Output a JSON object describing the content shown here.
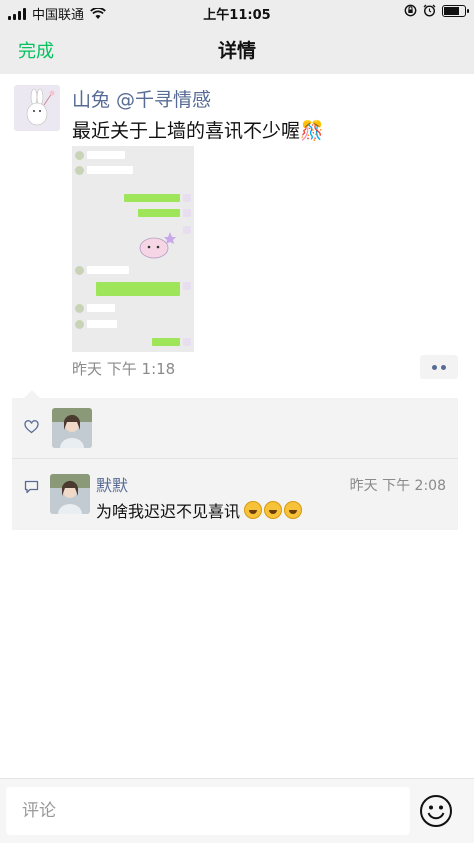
{
  "status_bar": {
    "carrier": "中国联通",
    "time": "上午11:05",
    "battery_level": 0.9
  },
  "nav": {
    "done_label": "完成",
    "title": "详情"
  },
  "post": {
    "author": "山兔 @千寻情感",
    "text": "最近关于上墙的喜讯不少喔",
    "text_emoji": "🎊",
    "time": "昨天 下午 1:18"
  },
  "likes": {
    "count": 1
  },
  "comment": {
    "author": "默默",
    "time": "昨天 下午 2:08",
    "text": "为啥我迟迟不见喜讯",
    "emoji_count": 3
  },
  "comment_input": {
    "placeholder": "评论"
  },
  "icons": [
    "signal-icon",
    "wifi-icon",
    "lock-rotation-icon",
    "alarm-icon",
    "battery-icon",
    "heart-icon",
    "comment-icon",
    "emoji-icon",
    "more-icon"
  ],
  "colors": {
    "accent_green": "#07c160",
    "link_blue": "#576b95",
    "bar_gray": "#ededed"
  }
}
